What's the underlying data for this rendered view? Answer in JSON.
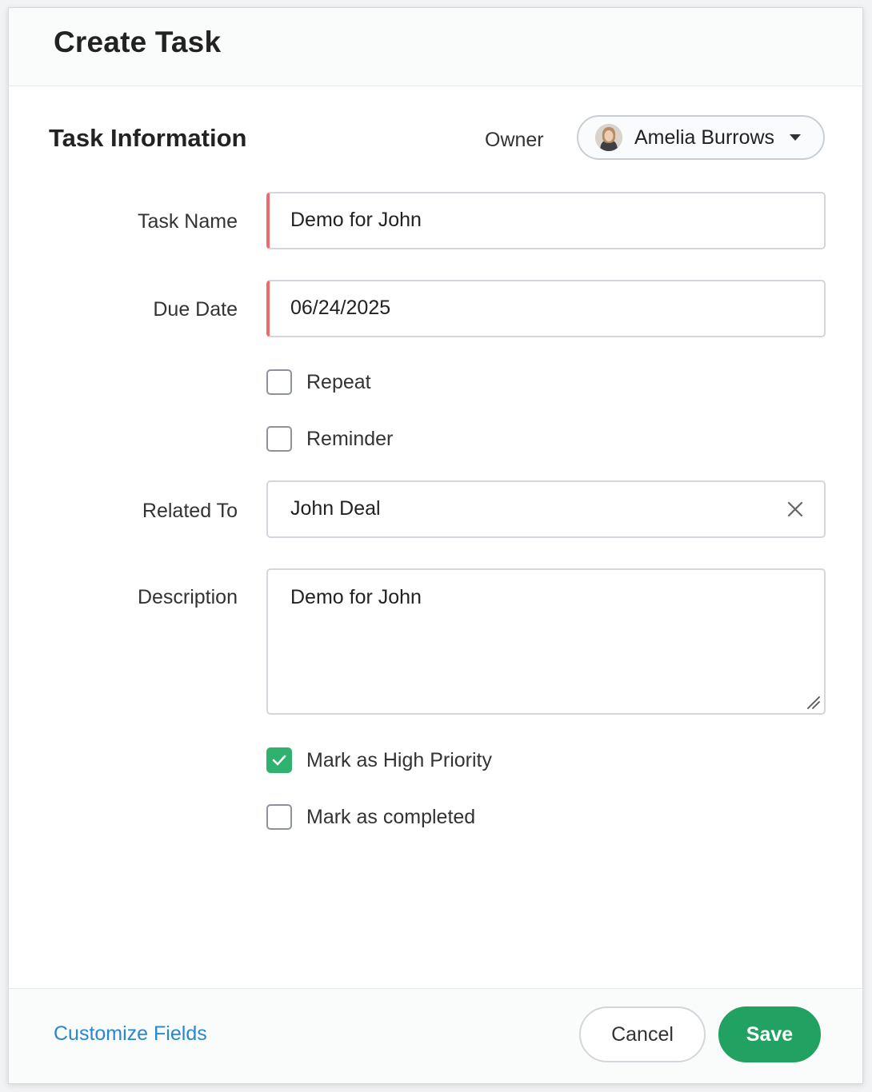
{
  "dialog": {
    "title": "Create Task"
  },
  "section": {
    "title": "Task Information",
    "owner_label": "Owner",
    "owner_name": "Amelia Burrows"
  },
  "fields": {
    "task_name": {
      "label": "Task Name",
      "value": "Demo for John"
    },
    "due_date": {
      "label": "Due Date",
      "value": "06/24/2025"
    },
    "related_to": {
      "label": "Related To",
      "value": "John Deal"
    },
    "description": {
      "label": "Description",
      "value": "Demo for John"
    }
  },
  "options": {
    "repeat": {
      "label": "Repeat",
      "checked": false
    },
    "reminder": {
      "label": "Reminder",
      "checked": false
    },
    "high_priority": {
      "label": "Mark as High Priority",
      "checked": true
    },
    "completed": {
      "label": "Mark as completed",
      "checked": false
    }
  },
  "footer": {
    "customize_label": "Customize Fields",
    "cancel_label": "Cancel",
    "save_label": "Save"
  },
  "colors": {
    "accent_green": "#22a262",
    "link_blue": "#2a86d0",
    "required_red": "#ef6b6b"
  }
}
